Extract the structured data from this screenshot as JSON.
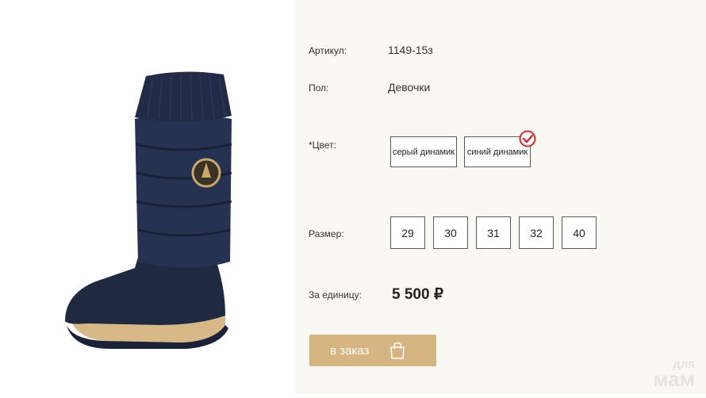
{
  "product": {
    "article_label": "Артикул:",
    "article_value": "1149-15з",
    "gender_label": "Пол:",
    "gender_value": "Девочки",
    "color_label": "*Цвет:",
    "colors": [
      "серый динамик",
      "синий динамик"
    ],
    "selected_color": "синий динамик",
    "size_label": "Размер:",
    "sizes": [
      "29",
      "30",
      "31",
      "32",
      "40"
    ],
    "price_label": "За единицу:",
    "price_value": "5 500 ₽",
    "order_label": "в заказ"
  },
  "watermark": {
    "line1": "для",
    "line2": "мам"
  },
  "colors": {
    "accent": "#d6b582",
    "check": "#d9252b",
    "boot": "#1e2a44",
    "sole": "#d9b887"
  }
}
